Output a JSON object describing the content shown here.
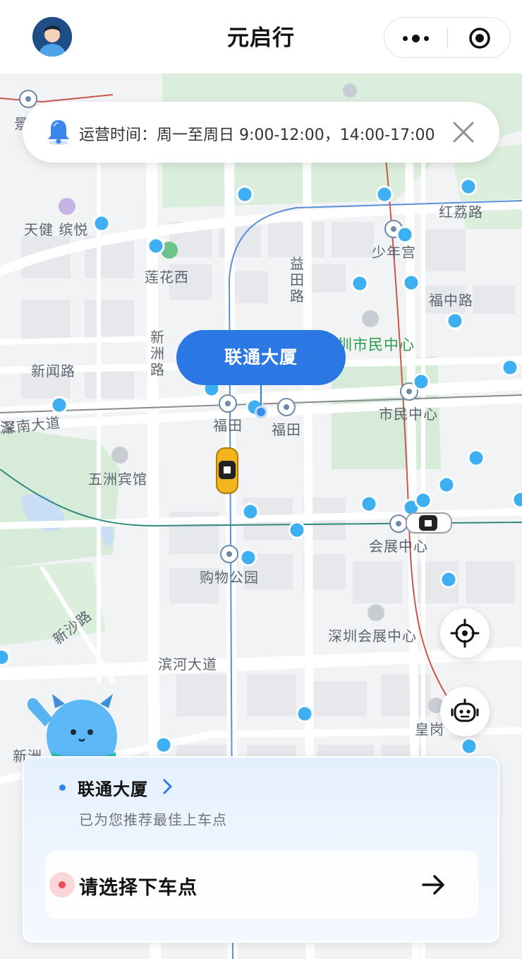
{
  "header": {
    "title": "元启行",
    "avatar_icon": "user-avatar",
    "more_icon": "more-dots-icon",
    "close_icon": "miniprogram-close-icon"
  },
  "notice": {
    "text": "运营时间：周一至周日 9:00-12:00，14:00-17:00",
    "icon": "bell-icon",
    "close_icon": "close-icon"
  },
  "map": {
    "selected_location": "联通大厦",
    "roads": [
      "红荔路",
      "福中路",
      "新闻路",
      "深南大道",
      "新沙路",
      "滨河大道"
    ],
    "road_vertical": {
      "yitian": "益田路",
      "xinzhou": "新洲路"
    },
    "stations": [
      "莲花西",
      "少年宫",
      "福田",
      "福田",
      "市民中心",
      "会展中心",
      "购物公园",
      "皇岗"
    ],
    "pois": [
      "天健 缤悦",
      "五洲宾馆",
      "深圳会展中心"
    ],
    "green_poi": "圳市民中心",
    "edge_left_top": "景",
    "edge_left_mid": "深",
    "edge_bottom_left": "新洲",
    "locate_icon": "crosshair-icon",
    "assistant_icon": "robot-icon",
    "accent_color": "#2b78e4"
  },
  "panel": {
    "pickup_name": "联通大厦",
    "pickup_hint": "已为您推荐最佳上车点",
    "destination_placeholder": "请选择下车点"
  }
}
